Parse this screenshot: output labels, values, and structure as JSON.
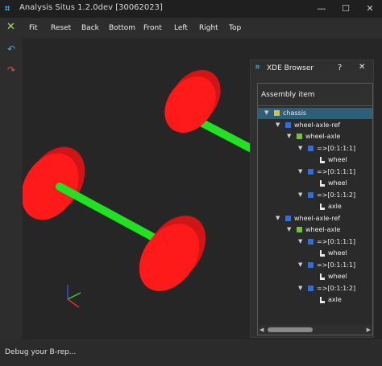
{
  "window": {
    "title": "Analysis Situs 1.2.0dev [30062023]",
    "icon": "app-logo-icon",
    "controls": [
      "—",
      "☐",
      "✕"
    ]
  },
  "toolbar": {
    "icon": "fit-x-icon",
    "items": [
      "Fit",
      "Reset",
      "Back",
      "Bottom",
      "Front",
      "Left",
      "Right",
      "Top"
    ]
  },
  "sidebar": {
    "buttons": [
      "undo-icon",
      "redo-icon"
    ],
    "colors": {
      "undo": "#4aa3df",
      "redo": "#e0504a"
    }
  },
  "viewport": {
    "background": "#262626",
    "wheel_color": "#ff1a1a",
    "axle_color": "#22e022",
    "triad_colors": {
      "x": "#e03030",
      "y": "#30d030",
      "z": "#3050e0"
    }
  },
  "status": {
    "text": "Debug your B-rep..."
  },
  "xde_browser": {
    "title": "XDE Browser",
    "help": "?",
    "close": "✕",
    "column_header": "Assembly item",
    "selection_color": "#2f5f78",
    "rows": [
      {
        "label": "chassis",
        "icon": "yellow",
        "arrow": "▼",
        "selected": true
      },
      {
        "label": "wheel-axle-ref",
        "icon": "blue",
        "arrow": "▼"
      },
      {
        "label": "wheel-axle",
        "icon": "green",
        "arrow": "▼"
      },
      {
        "label": "=>[0:1:1:1]",
        "icon": "blue",
        "arrow": "▼"
      },
      {
        "label": "wheel",
        "icon": "white",
        "arrow": ""
      },
      {
        "label": "=>[0:1:1:1]",
        "icon": "blue",
        "arrow": "▼"
      },
      {
        "label": "wheel",
        "icon": "white",
        "arrow": ""
      },
      {
        "label": "=>[0:1:1:2]",
        "icon": "blue",
        "arrow": "▼"
      },
      {
        "label": "axle",
        "icon": "white",
        "arrow": ""
      },
      {
        "label": "wheel-axle-ref",
        "icon": "blue",
        "arrow": "▼"
      },
      {
        "label": "wheel-axle",
        "icon": "green",
        "arrow": "▼"
      },
      {
        "label": "=>[0:1:1:1]",
        "icon": "blue",
        "arrow": "▼"
      },
      {
        "label": "wheel",
        "icon": "white",
        "arrow": ""
      },
      {
        "label": "=>[0:1:1:1]",
        "icon": "blue",
        "arrow": "▼"
      },
      {
        "label": "wheel",
        "icon": "white",
        "arrow": ""
      },
      {
        "label": "=>[0:1:1:2]",
        "icon": "blue",
        "arrow": "▼"
      },
      {
        "label": "axle",
        "icon": "white",
        "arrow": ""
      }
    ]
  }
}
